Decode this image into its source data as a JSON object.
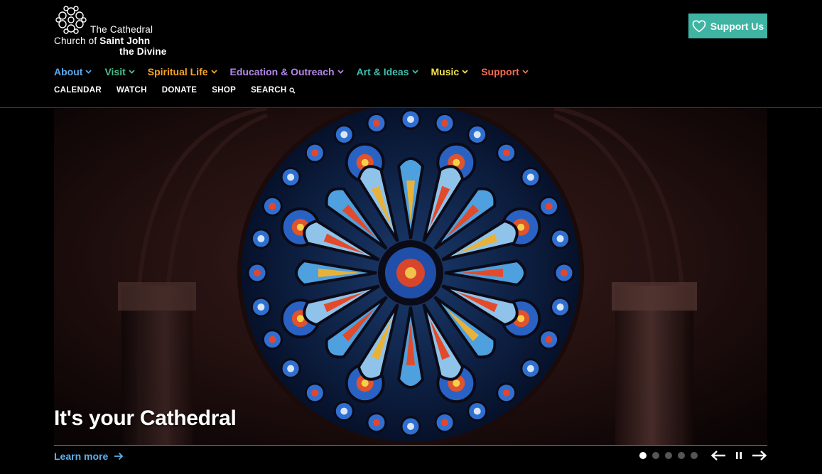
{
  "logo": {
    "line1": "The Cathedral",
    "line2_prefix": "Church of ",
    "line2_bold": "Saint John",
    "line3": "the Divine"
  },
  "support_button": {
    "label": "Support Us",
    "icon": "heart-icon",
    "color": "#3fb4a3"
  },
  "main_nav": [
    {
      "label": "About",
      "color": "#5ea9e8"
    },
    {
      "label": "Visit",
      "color": "#4cc08e"
    },
    {
      "label": "Spiritual Life",
      "color": "#f5a623"
    },
    {
      "label": "Education & Outreach",
      "color": "#b487e6"
    },
    {
      "label": "Art & Ideas",
      "color": "#3fbfae"
    },
    {
      "label": "Music",
      "color": "#f2e14c"
    },
    {
      "label": "Support",
      "color": "#f36c4f"
    }
  ],
  "util_nav": [
    {
      "label": "CALENDAR"
    },
    {
      "label": "WATCH"
    },
    {
      "label": "DONATE"
    },
    {
      "label": "SHOP"
    },
    {
      "label": "SEARCH",
      "icon": "search-icon"
    }
  ],
  "hero": {
    "title": "It's your Cathedral",
    "image": "rose-window-image",
    "learn_more": "Learn more",
    "slides": 5,
    "active_slide": 1
  }
}
